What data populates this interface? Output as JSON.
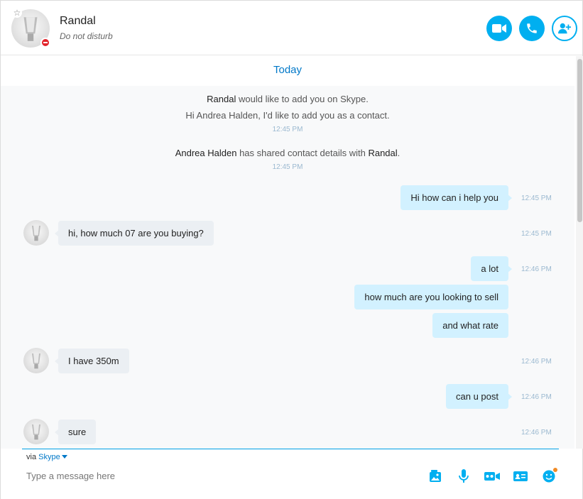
{
  "header": {
    "contact_name": "Randal",
    "status_text": "Do not disturb",
    "star_glyph": "☆"
  },
  "chat": {
    "date_divider": "Today",
    "system_events": [
      {
        "line1_name": "Randal",
        "line1_rest": " would like to add you on Skype.",
        "line2": "Hi Andrea Halden, I'd like to add you as a contact.",
        "time": "12:45 PM"
      },
      {
        "name_a": "Andrea Halden",
        "middle": " has shared contact details with ",
        "name_b": "Randal",
        "end": ".",
        "time": "12:45 PM"
      }
    ],
    "messages": [
      {
        "dir": "out",
        "text": "Hi how can i help you",
        "time": "12:45 PM"
      },
      {
        "dir": "in",
        "text": "hi, how much 07 are you buying?",
        "time": "12:45 PM"
      },
      {
        "dir": "out",
        "text": "a lot",
        "time": "12:46 PM"
      },
      {
        "dir": "out",
        "text": "how much are you looking to sell",
        "time": ""
      },
      {
        "dir": "out",
        "text": "and what rate",
        "time": ""
      },
      {
        "dir": "in",
        "text": "I have 350m",
        "time": "12:46 PM"
      },
      {
        "dir": "out",
        "text": "can u post",
        "time": "12:46 PM"
      },
      {
        "dir": "in",
        "text": "sure",
        "time": "12:46 PM"
      }
    ]
  },
  "compose": {
    "via_prefix": "via ",
    "via_service": "Skype",
    "placeholder": "Type a message here",
    "value": ""
  },
  "colors": {
    "accent": "#00aff0",
    "link_blue": "#0078c8",
    "outgoing_bubble": "#d2f1ff",
    "incoming_bubble": "#ebeff3",
    "dnd_red": "#e2242b"
  },
  "icons": {
    "video_call": "video-camera-icon",
    "audio_call": "phone-icon",
    "add_contact": "add-person-icon",
    "media": "image-icon",
    "voice": "microphone-icon",
    "video_msg": "video-message-icon",
    "contact_card": "contact-card-icon",
    "emoticon": "emoticon-icon"
  }
}
